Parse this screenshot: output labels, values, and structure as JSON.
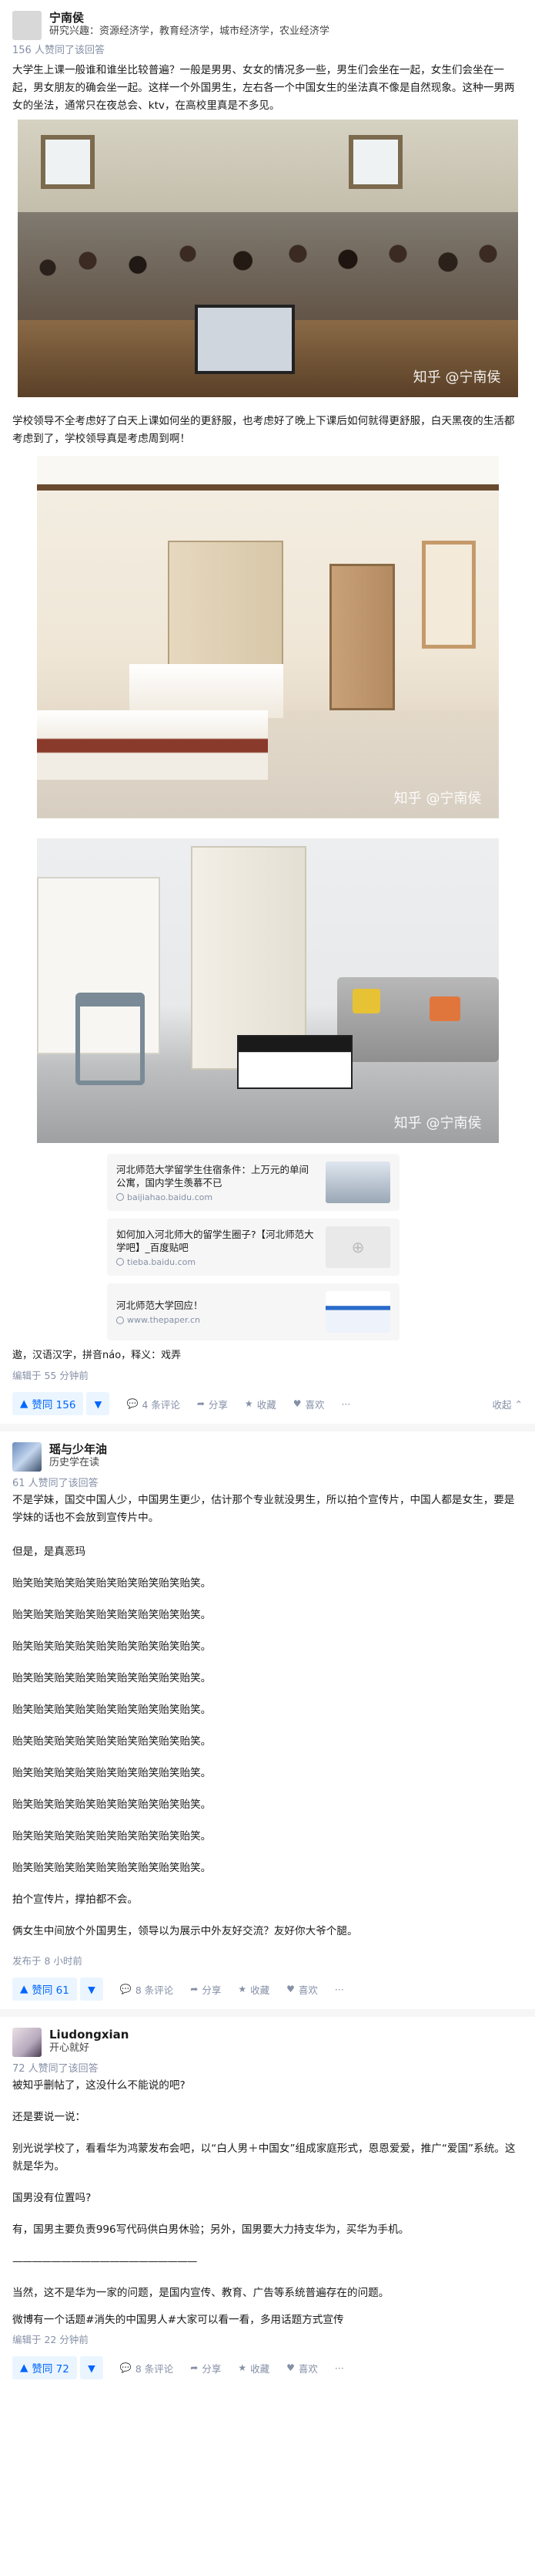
{
  "answers": [
    {
      "author": "宁南侯",
      "bio": "研究兴趣：资源经济学，教育经济学，城市经济学，农业经济学",
      "votes_line": "156 人赞同了该回答",
      "paragraphs": [
        "大学生上课一般谁和谁坐比较普遍？一般是男男、女女的情况多一些，男生们会坐在一起，女生们会坐在一起，男女朋友的确会坐一起。这样一个外国男生，左右各一个中国女生的坐法真不像是自然现象。这种一男两女的坐法，通常只在夜总会、ktv，在高校里真是不多见。",
        "学校领导不全考虑好了白天上课如何坐的更舒服，也考虑好了晚上下课后如何就得更舒服，白天黑夜的生活都考虑到了，学校领导真是考虑周到啊！"
      ],
      "watermark": "知乎 @宁南侯",
      "cards": [
        {
          "title": "河北师范大学留学生住宿条件：上万元的单间公寓，国内学生羡慕不已",
          "source": "baijiahao.baidu.com"
        },
        {
          "title": "如何加入河北师大的留学生圈子?【河北师范大学吧】_百度贴吧",
          "source": "tieba.baidu.com"
        },
        {
          "title": "河北师范大学回应！",
          "source": "www.thepaper.cn"
        }
      ],
      "footnote": "遨，汉语汉字，拼音náo，释义：戏弄",
      "edited": "编辑于 55 分钟前",
      "vote_label": "赞同 156",
      "comments": "4 条评论",
      "share": "分享",
      "collect": "收藏",
      "like": "喜欢",
      "collapse": "收起"
    },
    {
      "author": "瑶与少年油",
      "bio": "历史学在读",
      "votes_line": "61 人赞同了该回答",
      "paragraphs": [
        "不是学妹，国交中国人少，中国男生更少，估计那个专业就没男生，所以拍个宣传片，中国人都是女生，要是学妹的话也不会放到宣传片中。",
        "但是，是真恶玛"
      ],
      "repeat_line": "贻笑贻笑贻笑贻笑贻笑贻笑贻笑贻笑贻笑。",
      "repeat_count": 10,
      "after": [
        "拍个宣传片，撑拍都不会。",
        "俩女生中间放个外国男生，领导以为展示中外友好交流？友好你大爷个腿。"
      ],
      "edited": "发布于 8 小时前",
      "vote_label": "赞同 61",
      "comments": "8 条评论",
      "share": "分享",
      "collect": "收藏",
      "like": "喜欢"
    },
    {
      "author": "Liudongxian",
      "bio": "开心就好",
      "votes_line": "72 人赞同了该回答",
      "paragraphs": [
        "被知乎删帖了，这没什么不能说的吧?",
        "还是要说一说：",
        "别光说学校了，看看华为鸿蒙发布会吧，以“白人男＋中国女”组成家庭形式，恩恩爱爱，推广“爱国”系统。这就是华为。",
        "国男没有位置吗?",
        "有，国男主要负责996写代码供白男休验；另外，国男要大力持支华为，买华为手机。",
        "———————————————————",
        "当然，这不是华为一家的问题，是国内宣传、教育、广告等系统普遍存在的问题。",
        "微博有一个话题#消失的中国男人#大家可以看一看，多用话题方式宣传"
      ],
      "edited": "编辑于 22 分钟前",
      "vote_label": "赞同 72",
      "comments": "8 条评论",
      "share": "分享",
      "collect": "收藏",
      "like": "喜欢"
    }
  ]
}
